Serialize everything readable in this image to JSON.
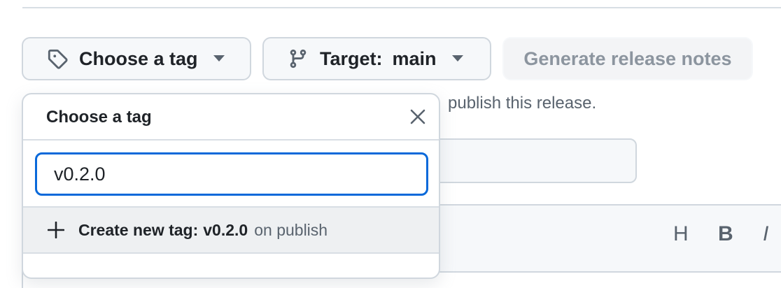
{
  "buttons": {
    "choose_tag": "Choose a tag",
    "target_label": "Target:",
    "target_value": "main",
    "generate_notes": "Generate release notes"
  },
  "help_text": "publish this release.",
  "dropdown": {
    "title": "Choose a tag",
    "filter_value": "v0.2.0",
    "create_item": {
      "prefix": "Create new tag:",
      "tag": "v0.2.0",
      "suffix": "on publish"
    }
  },
  "toolbar": {
    "heading": "H",
    "bold": "B",
    "italic": "I"
  },
  "colors": {
    "accent": "#0969da",
    "muted_text": "#59636e",
    "border": "#d0d7de"
  },
  "icons": [
    "tag-icon",
    "caret-down-icon",
    "git-branch-icon",
    "close-icon",
    "plus-icon"
  ]
}
